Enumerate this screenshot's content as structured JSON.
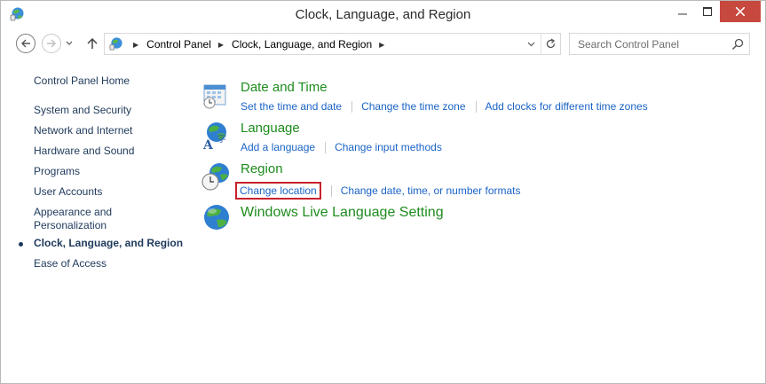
{
  "window": {
    "title": "Clock, Language, and Region",
    "close_color": "#c7483e"
  },
  "nav": {
    "breadcrumb": [
      "Control Panel",
      "Clock, Language, and Region"
    ],
    "search_placeholder": "Search Control Panel"
  },
  "sidebar": {
    "items": [
      {
        "label": "Control Panel Home"
      },
      {
        "label": "System and Security"
      },
      {
        "label": "Network and Internet"
      },
      {
        "label": "Hardware and Sound"
      },
      {
        "label": "Programs"
      },
      {
        "label": "User Accounts"
      },
      {
        "label": "Appearance and"
      },
      {
        "label": "Personalization"
      },
      {
        "label": "Clock, Language, and Region"
      },
      {
        "label": "Ease of Access"
      }
    ],
    "active_index": 8
  },
  "main": {
    "categories": [
      {
        "title": "Date and Time",
        "icon": "calendar-clock-icon",
        "links": [
          "Set the time and date",
          "Change the time zone",
          "Add clocks for different time zones"
        ]
      },
      {
        "title": "Language",
        "icon": "globe-language-icon",
        "links": [
          "Add a language",
          "Change input methods"
        ]
      },
      {
        "title": "Region",
        "icon": "globe-clock-icon",
        "links": [
          "Change location",
          "Change date, time, or number formats"
        ]
      },
      {
        "title": "Windows Live Language Setting",
        "icon": "globe-icon",
        "links": []
      }
    ],
    "title_color": "#1e8c1e",
    "link_color": "#1a63c6",
    "highlight_color": "#c8212d"
  }
}
